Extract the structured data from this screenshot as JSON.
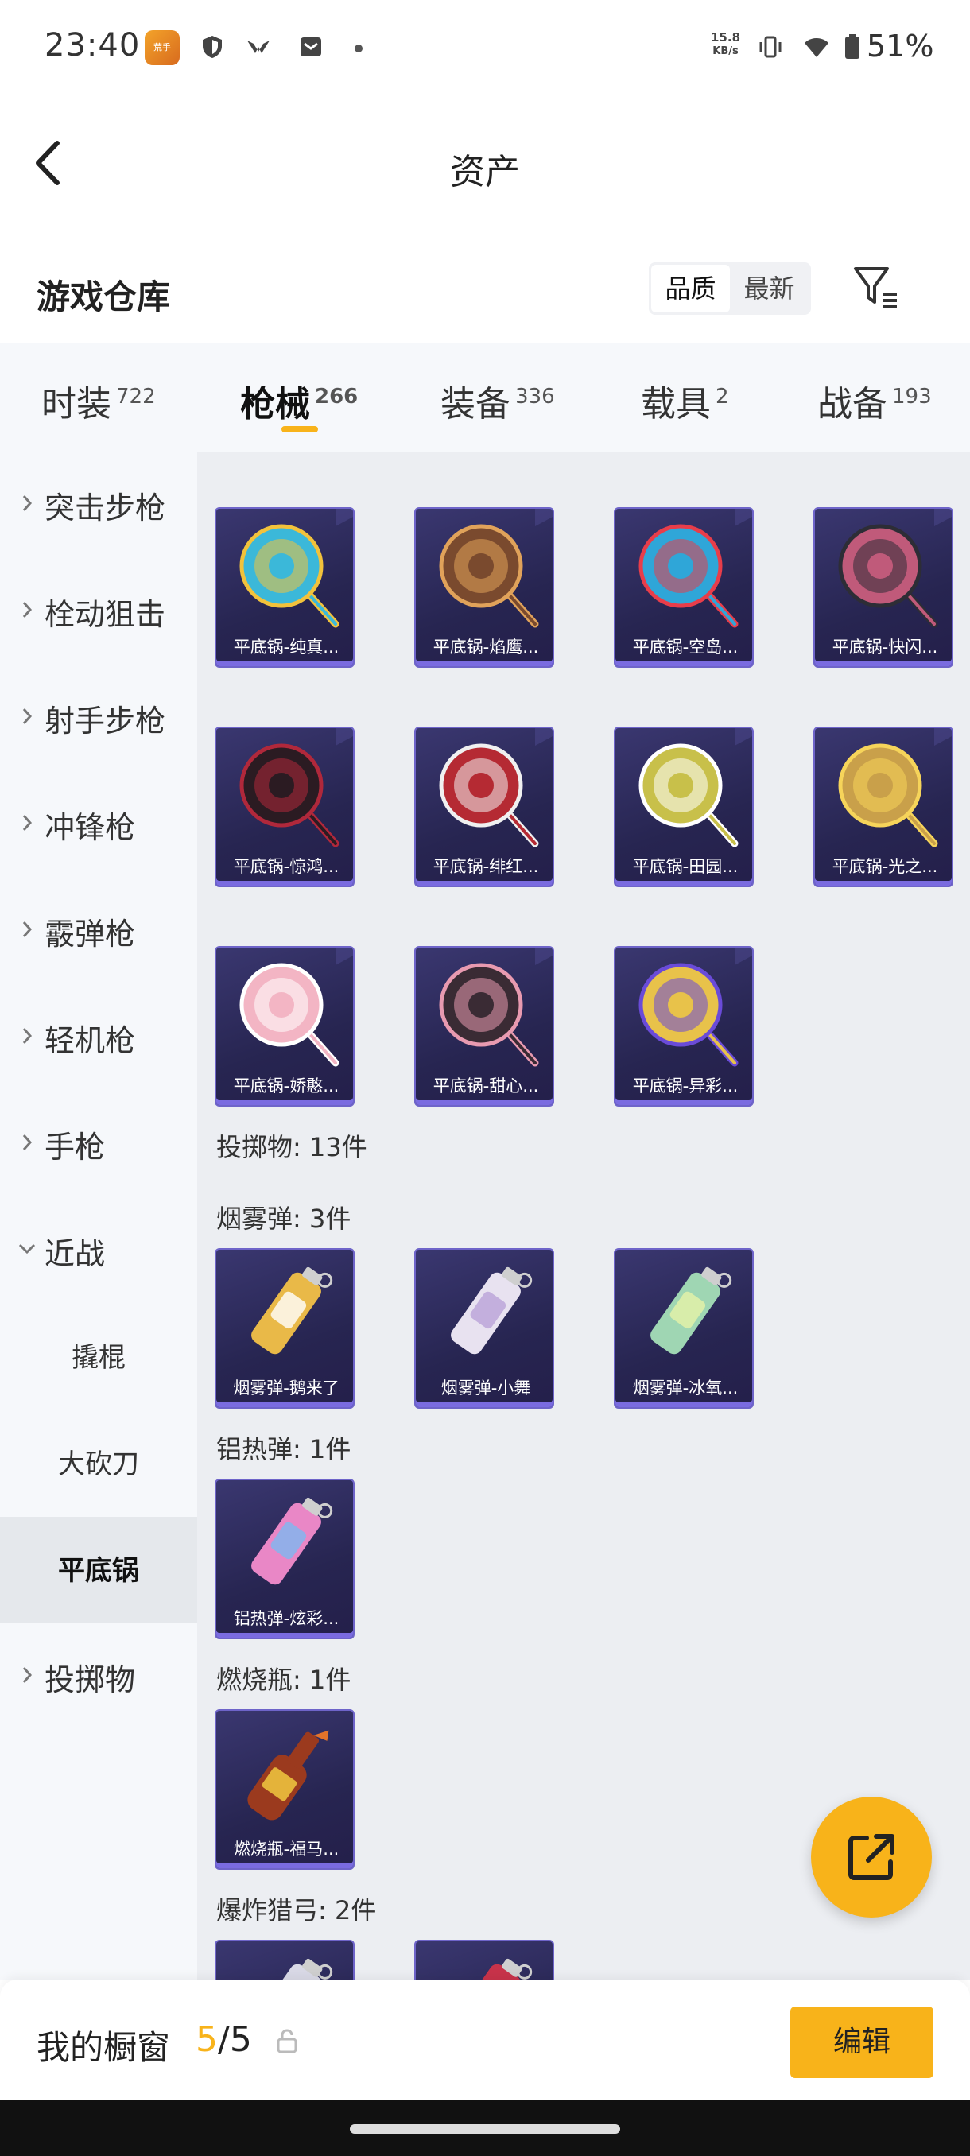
{
  "status_bar": {
    "time": "23:40",
    "net_speed_value": "15.8",
    "net_speed_unit": "KB/s",
    "battery": "51%",
    "app_icon_text": "荒手",
    "icons": [
      "app-icon",
      "shield-icon",
      "vpn-icon",
      "mail-icon",
      "dot-icon",
      "vibrate-icon",
      "wifi-icon",
      "battery-icon"
    ]
  },
  "header": {
    "title": "资产"
  },
  "warehouse": {
    "title": "游戏仓库",
    "sort_options": [
      "品质",
      "最新"
    ],
    "active_sort": "品质"
  },
  "tabs": [
    {
      "label": "时装",
      "count": "722"
    },
    {
      "label": "枪械",
      "count": "266",
      "active": true
    },
    {
      "label": "装备",
      "count": "336"
    },
    {
      "label": "载具",
      "count": "2"
    },
    {
      "label": "战备",
      "count": "193"
    }
  ],
  "sidebar": [
    {
      "label": "突击步枪",
      "type": "group"
    },
    {
      "label": "栓动狙击",
      "type": "group"
    },
    {
      "label": "射手步枪",
      "type": "group"
    },
    {
      "label": "冲锋枪",
      "type": "group"
    },
    {
      "label": "霰弹枪",
      "type": "group"
    },
    {
      "label": "轻机枪",
      "type": "group"
    },
    {
      "label": "手枪",
      "type": "group"
    },
    {
      "label": "近战",
      "type": "group",
      "expanded": true
    },
    {
      "label": "撬棍",
      "type": "sub"
    },
    {
      "label": "大砍刀",
      "type": "sub"
    },
    {
      "label": "平底锅",
      "type": "sub",
      "active": true
    },
    {
      "label": "投掷物",
      "type": "group"
    }
  ],
  "pans": [
    {
      "name": "平底锅-纯真...",
      "color": "#3bb8d9",
      "accent": "#f2c23b"
    },
    {
      "name": "平底锅-焰鹰...",
      "color": "#7a4a2e",
      "accent": "#e0a25a"
    },
    {
      "name": "平底锅-空岛...",
      "color": "#2fa6d8",
      "accent": "#e83d4a"
    },
    {
      "name": "平底锅-快闪...",
      "color": "#c05a7a",
      "accent": "#2d2d36"
    },
    {
      "name": "平底锅-惊鸿...",
      "color": "#2b1b22",
      "accent": "#b0283b"
    },
    {
      "name": "平底锅-绯红...",
      "color": "#b52a33",
      "accent": "#f0f0f0"
    },
    {
      "name": "平底锅-田园...",
      "color": "#c8c04a",
      "accent": "#ffffff"
    },
    {
      "name": "平底锅-光之...",
      "color": "#c9a04a",
      "accent": "#f6d45a"
    },
    {
      "name": "平底锅-娇憨...",
      "color": "#f3b5c4",
      "accent": "#ffffff"
    },
    {
      "name": "平底锅-甜心...",
      "color": "#3a2b34",
      "accent": "#e89ab0"
    },
    {
      "name": "平底锅-异彩...",
      "color": "#e8c24a",
      "accent": "#6a4bd8"
    }
  ],
  "throwables": {
    "title": "投掷物: 13件",
    "groups": [
      {
        "title": "烟雾弹: 3件",
        "items": [
          {
            "name": "烟雾弹-鹅来了",
            "color": "#e9b948",
            "accent": "#ffffff"
          },
          {
            "name": "烟雾弹-小舞",
            "color": "#e8e2f0",
            "accent": "#b9a3d8"
          },
          {
            "name": "烟雾弹-冰氧...",
            "color": "#9fd6b3",
            "accent": "#e6f3a8"
          }
        ]
      },
      {
        "title": "铝热弹: 1件",
        "items": [
          {
            "name": "铝热弹-炫彩...",
            "color": "#e987c6",
            "accent": "#7db8f0"
          }
        ]
      },
      {
        "title": "燃烧瓶: 1件",
        "items": [
          {
            "name": "燃烧瓶-福马...",
            "color": "#9b3a1e",
            "accent": "#e4b33a"
          }
        ]
      },
      {
        "title": "爆炸猎弓: 2件",
        "items": [
          {
            "name": "",
            "color": "#d9d9e6",
            "accent": "#ffffff"
          },
          {
            "name": "",
            "color": "#c8334a",
            "accent": "#ffffff"
          }
        ]
      }
    ]
  },
  "bottom_bar": {
    "label": "我的橱窗",
    "current": "5",
    "total": "5",
    "edit_label": "编辑"
  },
  "colors": {
    "accent": "#f8b31a",
    "card_bg": "#2a2756",
    "card_border": "#6e64c9"
  }
}
